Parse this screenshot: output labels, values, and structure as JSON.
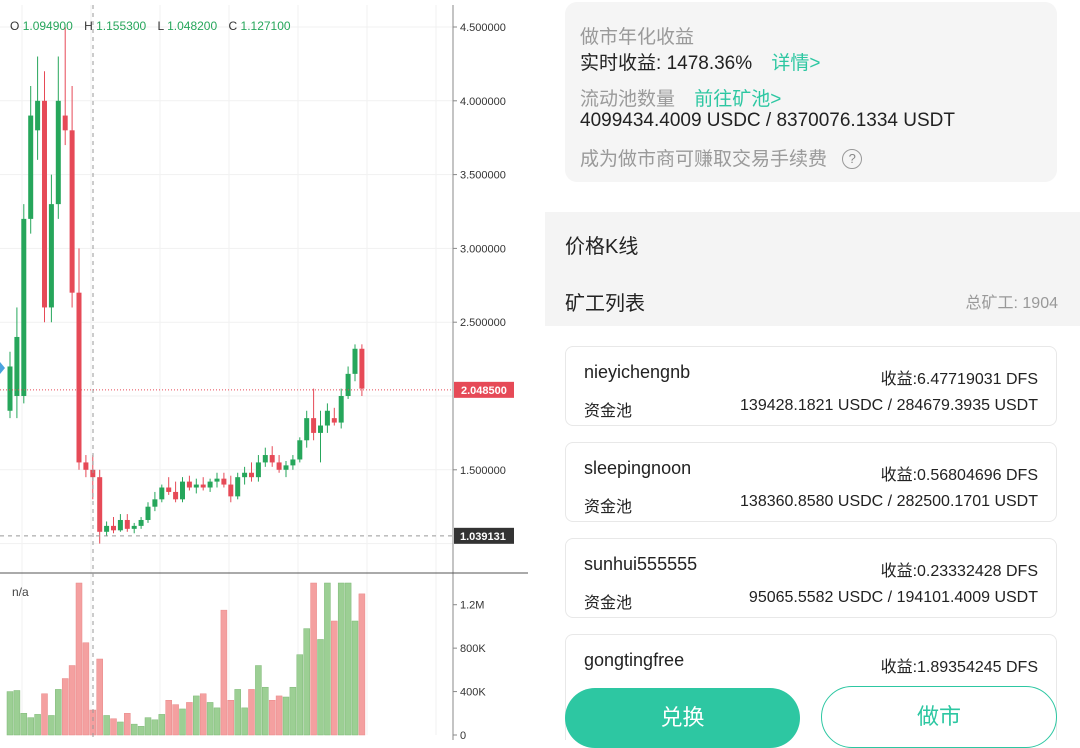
{
  "ohlc": {
    "o_label": "O",
    "o_value": "1.094900",
    "h_label": "H",
    "h_value": "1.155300",
    "l_label": "L",
    "l_value": "1.048200",
    "c_label": "C",
    "c_value": "1.127100"
  },
  "price_axis": {
    "ticks": [
      "4.500000",
      "4.000000",
      "3.500000",
      "3.000000",
      "2.500000",
      "1.500000"
    ],
    "current_price": "2.048500",
    "low_marker": "1.039131"
  },
  "volume_axis": {
    "label": "n/a",
    "ticks": [
      "1.2M",
      "800K",
      "400K",
      "0"
    ]
  },
  "colors": {
    "up": "#26a65b",
    "down": "#e64a57",
    "accent": "#2dc7a2",
    "up_vol": "#9ccf94",
    "down_vol": "#f4a0a0"
  },
  "chart_data": {
    "type": "candlestick",
    "ylim": [
      0.9,
      4.6
    ],
    "volume_ylim": [
      0,
      1400000
    ],
    "candles": [
      {
        "o": 1.9,
        "h": 2.3,
        "l": 1.85,
        "c": 2.2,
        "v": 400000
      },
      {
        "o": 2.0,
        "h": 2.6,
        "l": 1.85,
        "c": 2.4,
        "v": 410000
      },
      {
        "o": 2.0,
        "h": 3.3,
        "l": 1.95,
        "c": 3.2,
        "v": 200000
      },
      {
        "o": 3.2,
        "h": 4.1,
        "l": 3.1,
        "c": 3.9,
        "v": 160000
      },
      {
        "o": 3.8,
        "h": 4.3,
        "l": 3.6,
        "c": 4.0,
        "v": 190000
      },
      {
        "o": 4.0,
        "h": 4.2,
        "l": 2.5,
        "c": 2.6,
        "v": 380000
      },
      {
        "o": 2.6,
        "h": 3.5,
        "l": 2.5,
        "c": 3.3,
        "v": 180000
      },
      {
        "o": 3.3,
        "h": 4.3,
        "l": 3.2,
        "c": 4.0,
        "v": 420000
      },
      {
        "o": 3.9,
        "h": 4.5,
        "l": 3.7,
        "c": 3.8,
        "v": 520000
      },
      {
        "o": 3.8,
        "h": 4.1,
        "l": 2.6,
        "c": 2.7,
        "v": 640000
      },
      {
        "o": 2.7,
        "h": 3.0,
        "l": 1.5,
        "c": 1.55,
        "v": 1400000
      },
      {
        "o": 1.55,
        "h": 1.6,
        "l": 1.45,
        "c": 1.5,
        "v": 850000
      },
      {
        "o": 1.5,
        "h": 1.6,
        "l": 1.3,
        "c": 1.45,
        "v": 230000
      },
      {
        "o": 1.45,
        "h": 1.5,
        "l": 1.0,
        "c": 1.08,
        "v": 700000
      },
      {
        "o": 1.08,
        "h": 1.15,
        "l": 1.05,
        "c": 1.12,
        "v": 180000
      },
      {
        "o": 1.12,
        "h": 1.18,
        "l": 1.07,
        "c": 1.09,
        "v": 150000
      },
      {
        "o": 1.09,
        "h": 1.2,
        "l": 1.08,
        "c": 1.16,
        "v": 120000
      },
      {
        "o": 1.16,
        "h": 1.2,
        "l": 1.08,
        "c": 1.1,
        "v": 200000
      },
      {
        "o": 1.1,
        "h": 1.14,
        "l": 1.07,
        "c": 1.12,
        "v": 100000
      },
      {
        "o": 1.12,
        "h": 1.18,
        "l": 1.1,
        "c": 1.16,
        "v": 80000
      },
      {
        "o": 1.16,
        "h": 1.28,
        "l": 1.14,
        "c": 1.25,
        "v": 160000
      },
      {
        "o": 1.25,
        "h": 1.35,
        "l": 1.22,
        "c": 1.3,
        "v": 140000
      },
      {
        "o": 1.3,
        "h": 1.4,
        "l": 1.28,
        "c": 1.38,
        "v": 190000
      },
      {
        "o": 1.38,
        "h": 1.45,
        "l": 1.33,
        "c": 1.35,
        "v": 320000
      },
      {
        "o": 1.35,
        "h": 1.42,
        "l": 1.28,
        "c": 1.3,
        "v": 280000
      },
      {
        "o": 1.3,
        "h": 1.45,
        "l": 1.28,
        "c": 1.42,
        "v": 240000
      },
      {
        "o": 1.42,
        "h": 1.46,
        "l": 1.36,
        "c": 1.38,
        "v": 300000
      },
      {
        "o": 1.38,
        "h": 1.44,
        "l": 1.34,
        "c": 1.4,
        "v": 360000
      },
      {
        "o": 1.4,
        "h": 1.45,
        "l": 1.36,
        "c": 1.38,
        "v": 380000
      },
      {
        "o": 1.38,
        "h": 1.44,
        "l": 1.35,
        "c": 1.42,
        "v": 300000
      },
      {
        "o": 1.42,
        "h": 1.48,
        "l": 1.38,
        "c": 1.44,
        "v": 250000
      },
      {
        "o": 1.44,
        "h": 1.48,
        "l": 1.38,
        "c": 1.4,
        "v": 1150000
      },
      {
        "o": 1.4,
        "h": 1.46,
        "l": 1.28,
        "c": 1.32,
        "v": 320000
      },
      {
        "o": 1.32,
        "h": 1.48,
        "l": 1.3,
        "c": 1.45,
        "v": 420000
      },
      {
        "o": 1.45,
        "h": 1.52,
        "l": 1.4,
        "c": 1.48,
        "v": 250000
      },
      {
        "o": 1.48,
        "h": 1.55,
        "l": 1.42,
        "c": 1.45,
        "v": 420000
      },
      {
        "o": 1.45,
        "h": 1.6,
        "l": 1.42,
        "c": 1.55,
        "v": 640000
      },
      {
        "o": 1.55,
        "h": 1.65,
        "l": 1.52,
        "c": 1.6,
        "v": 440000
      },
      {
        "o": 1.6,
        "h": 1.66,
        "l": 1.52,
        "c": 1.55,
        "v": 320000
      },
      {
        "o": 1.55,
        "h": 1.6,
        "l": 1.48,
        "c": 1.5,
        "v": 360000
      },
      {
        "o": 1.5,
        "h": 1.56,
        "l": 1.45,
        "c": 1.53,
        "v": 350000
      },
      {
        "o": 1.53,
        "h": 1.6,
        "l": 1.5,
        "c": 1.57,
        "v": 440000
      },
      {
        "o": 1.57,
        "h": 1.72,
        "l": 1.55,
        "c": 1.7,
        "v": 740000
      },
      {
        "o": 1.7,
        "h": 1.9,
        "l": 1.65,
        "c": 1.85,
        "v": 980000
      },
      {
        "o": 1.85,
        "h": 2.05,
        "l": 1.7,
        "c": 1.75,
        "v": 1400000
      },
      {
        "o": 1.75,
        "h": 1.9,
        "l": 1.55,
        "c": 1.8,
        "v": 880000
      },
      {
        "o": 1.8,
        "h": 1.95,
        "l": 1.75,
        "c": 1.9,
        "v": 1400000
      },
      {
        "o": 1.85,
        "h": 1.92,
        "l": 1.8,
        "c": 1.82,
        "v": 1050000
      },
      {
        "o": 1.82,
        "h": 2.05,
        "l": 1.78,
        "c": 2.0,
        "v": 1400000
      },
      {
        "o": 2.0,
        "h": 2.2,
        "l": 1.98,
        "c": 2.15,
        "v": 1400000
      },
      {
        "o": 2.15,
        "h": 2.35,
        "l": 2.1,
        "c": 2.32,
        "v": 1050000
      },
      {
        "o": 2.32,
        "h": 2.35,
        "l": 2.0,
        "c": 2.05,
        "v": 1300000
      }
    ]
  },
  "info": {
    "annual_title": "做市年化收益",
    "realtime_label": "实时收益:",
    "realtime_value": "1478.36%",
    "details_link": "详情>",
    "pool_label": "流动池数量",
    "pool_link": "前往矿池>",
    "pool_value": "4099434.4009 USDC / 8370076.1334 USDT",
    "fee_note": "成为做市商可赚取交易手续费",
    "help_glyph": "?"
  },
  "sections": {
    "kline": "价格K线",
    "miners": "矿工列表",
    "total_label": "总矿工:",
    "total_value": "1904"
  },
  "miners": [
    {
      "name": "nieyichengnb",
      "earn_label": "收益:",
      "earn_value": "6.47719031 DFS",
      "pool_label": "资金池",
      "pool_value": "139428.1821 USDC / 284679.3935 USDT"
    },
    {
      "name": "sleepingnoon",
      "earn_label": "收益:",
      "earn_value": "0.56804696 DFS",
      "pool_label": "资金池",
      "pool_value": "138360.8580 USDC / 282500.1701 USDT"
    },
    {
      "name": "sunhui555555",
      "earn_label": "收益:",
      "earn_value": "0.23332428 DFS",
      "pool_label": "资金池",
      "pool_value": "95065.5582 USDC / 194101.4009 USDT"
    },
    {
      "name": "gongtingfree",
      "earn_label": "收益:",
      "earn_value": "1.89354245 DFS",
      "pool_label": "",
      "pool_value": ""
    }
  ],
  "buttons": {
    "swap": "兑换",
    "market_make": "做市"
  }
}
